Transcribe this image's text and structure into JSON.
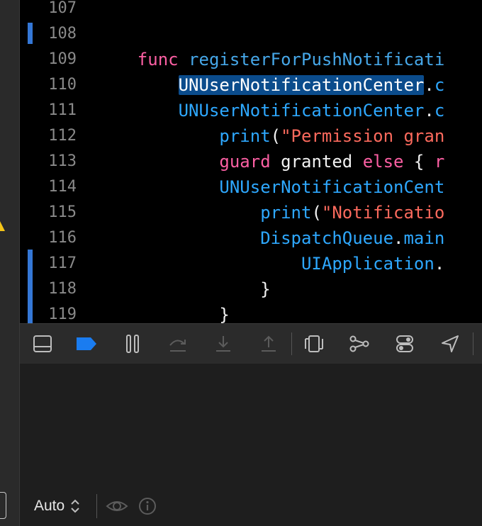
{
  "editor": {
    "lines": [
      {
        "num": "107",
        "tokens": []
      },
      {
        "num": "108",
        "tokens": []
      },
      {
        "num": "109",
        "tokens": [
          {
            "text": "    ",
            "kind": "plain"
          },
          {
            "text": "func",
            "kind": "kw"
          },
          {
            "text": " ",
            "kind": "plain"
          },
          {
            "text": "registerForPushNotificati",
            "kind": "fn"
          }
        ]
      },
      {
        "num": "110",
        "tokens": [
          {
            "text": "        ",
            "kind": "plain"
          },
          {
            "text": "UNUserNotificationCenter",
            "kind": "sel"
          },
          {
            "text": ".",
            "kind": "plain"
          },
          {
            "text": "c",
            "kind": "type"
          }
        ]
      },
      {
        "num": "111",
        "tokens": [
          {
            "text": "        ",
            "kind": "plain"
          },
          {
            "text": "UNUserNotificationCenter",
            "kind": "type"
          },
          {
            "text": ".",
            "kind": "plain"
          },
          {
            "text": "c",
            "kind": "type"
          }
        ]
      },
      {
        "num": "112",
        "tokens": [
          {
            "text": "            ",
            "kind": "plain"
          },
          {
            "text": "print",
            "kind": "type"
          },
          {
            "text": "(",
            "kind": "plain"
          },
          {
            "text": "\"Permission gran",
            "kind": "str"
          }
        ]
      },
      {
        "num": "113",
        "tokens": [
          {
            "text": "            ",
            "kind": "plain"
          },
          {
            "text": "guard",
            "kind": "kw"
          },
          {
            "text": " granted ",
            "kind": "plain"
          },
          {
            "text": "else",
            "kind": "kw"
          },
          {
            "text": " { ",
            "kind": "plain"
          },
          {
            "text": "r",
            "kind": "kw"
          }
        ]
      },
      {
        "num": "114",
        "tokens": [
          {
            "text": "            ",
            "kind": "plain"
          },
          {
            "text": "UNUserNotificationCent",
            "kind": "type"
          }
        ]
      },
      {
        "num": "115",
        "tokens": [
          {
            "text": "                ",
            "kind": "plain"
          },
          {
            "text": "print",
            "kind": "type"
          },
          {
            "text": "(",
            "kind": "plain"
          },
          {
            "text": "\"Notificatio",
            "kind": "str"
          }
        ]
      },
      {
        "num": "116",
        "tokens": [
          {
            "text": "                ",
            "kind": "plain"
          },
          {
            "text": "DispatchQueue",
            "kind": "type"
          },
          {
            "text": ".",
            "kind": "plain"
          },
          {
            "text": "main",
            "kind": "type"
          }
        ]
      },
      {
        "num": "117",
        "tokens": [
          {
            "text": "                    ",
            "kind": "plain"
          },
          {
            "text": "UIApplication",
            "kind": "type"
          },
          {
            "text": ".",
            "kind": "plain"
          }
        ]
      },
      {
        "num": "118",
        "tokens": [
          {
            "text": "                ",
            "kind": "plain"
          },
          {
            "text": "}",
            "kind": "plain"
          }
        ]
      },
      {
        "num": "119",
        "tokens": [
          {
            "text": "            ",
            "kind": "plain"
          },
          {
            "text": "}",
            "kind": "plain"
          }
        ]
      }
    ]
  },
  "toolbar": {
    "buttons": [
      {
        "name": "hide-debug-area-button",
        "icon": "panel-bottom-icon"
      },
      {
        "name": "breakpoints-toggle-button",
        "icon": "breakpoint-icon",
        "active": true
      },
      {
        "name": "pause-button",
        "icon": "pause-icon"
      },
      {
        "name": "step-over-button",
        "icon": "step-over-icon",
        "disabled": true
      },
      {
        "name": "step-into-button",
        "icon": "step-into-icon",
        "disabled": true
      },
      {
        "name": "step-out-button",
        "icon": "step-out-icon",
        "disabled": true
      },
      {
        "name": "view-hierarchy-button",
        "icon": "view-hierarchy-icon"
      },
      {
        "name": "memory-graph-button",
        "icon": "memory-graph-icon"
      },
      {
        "name": "environment-overrides-button",
        "icon": "environment-overrides-icon"
      },
      {
        "name": "simulate-location-button",
        "icon": "location-arrow-icon"
      }
    ]
  },
  "debug": {
    "variables_scope": "Auto"
  },
  "colors": {
    "accent": "#1a7cf0",
    "change_bar": "#3477d6",
    "keyword": "#fc5fa3",
    "type": "#2ea8ff",
    "string": "#fc6a5d",
    "warning": "#f5c518"
  }
}
